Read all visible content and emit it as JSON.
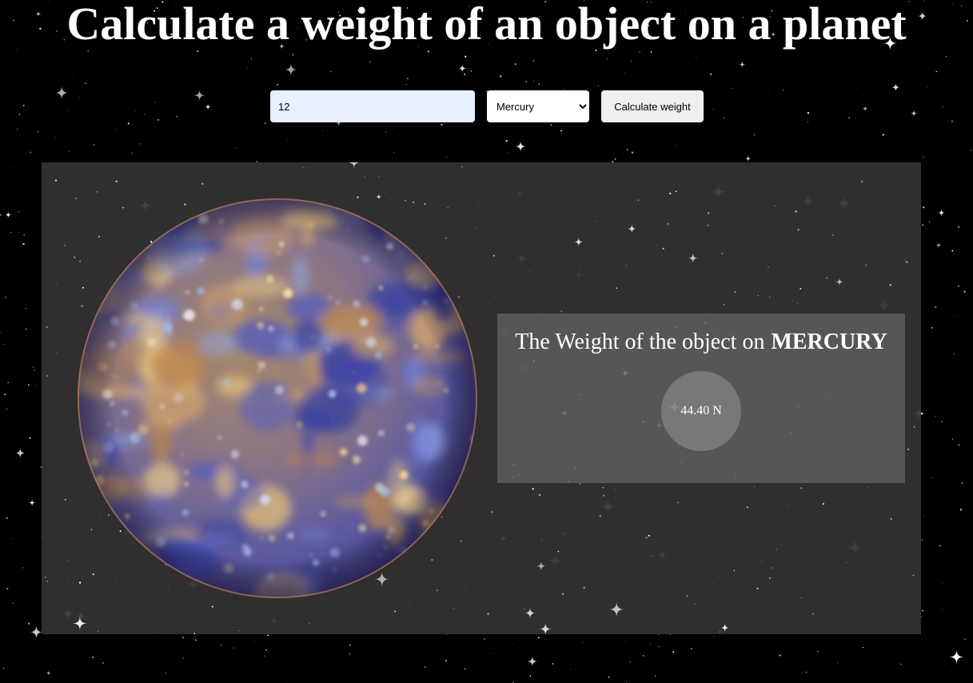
{
  "header": {
    "title": "Calculate a weight of an object on a planet"
  },
  "form": {
    "mass_value": "12",
    "selected_planet": "Mercury",
    "button_label": "Calculate weight"
  },
  "result": {
    "label": "The Weight of the object on",
    "planet_name": "MERCURY",
    "weight": "44.40 N"
  },
  "colors": {
    "page_background": "#000000",
    "panel_background": "#343231",
    "result_box_background": "#605f5f",
    "input_background": "#e8f0fe",
    "button_background": "#efefef",
    "text": "#ffffff"
  },
  "icons": {
    "planet_image": "planet-mercury-image",
    "select_arrow": "chevron-down-icon"
  }
}
